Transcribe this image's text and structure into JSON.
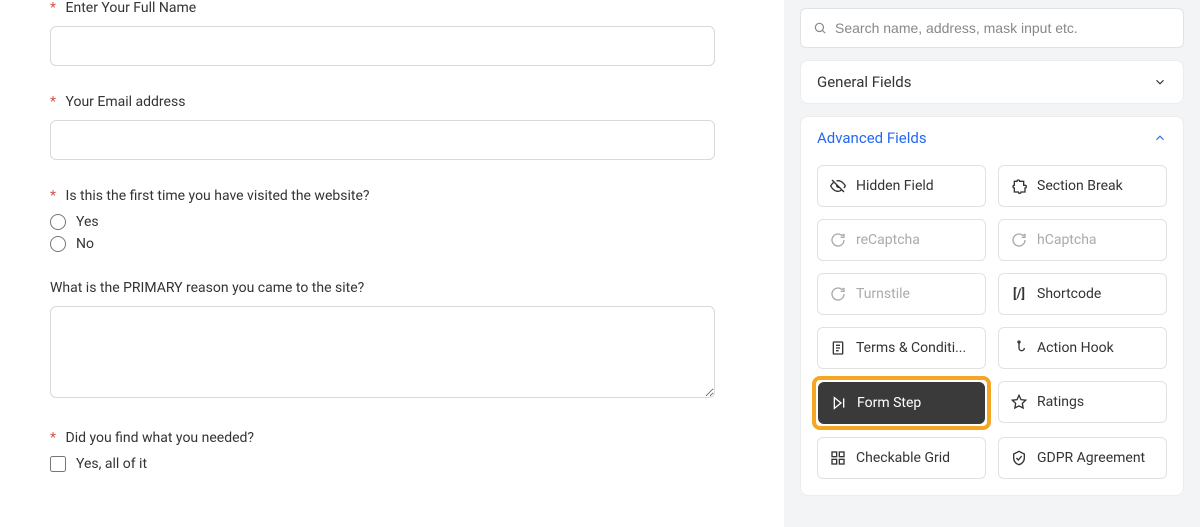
{
  "form": {
    "name": {
      "label": "Enter Your Full Name",
      "required": true
    },
    "email": {
      "label": "Your Email address",
      "required": true
    },
    "first": {
      "label": "Is this the first time you have visited the website?",
      "required": true,
      "opt_yes": "Yes",
      "opt_no": "No"
    },
    "reason": {
      "label": "What is the PRIMARY reason you came to the site?",
      "required": false
    },
    "needed": {
      "label": "Did you find what you needed?",
      "required": true,
      "opt_all": "Yes, all of it"
    }
  },
  "search": {
    "placeholder": "Search name, address, mask input etc."
  },
  "accordions": {
    "general": {
      "title": "General Fields"
    },
    "advanced": {
      "title": "Advanced Fields"
    }
  },
  "adv": {
    "hidden": "Hidden Field",
    "section": "Section Break",
    "recaptcha": "reCaptcha",
    "hcaptcha": "hCaptcha",
    "turnstile": "Turnstile",
    "shortcode": "Shortcode",
    "terms": "Terms & Conditi...",
    "action": "Action Hook",
    "formstep": "Form Step",
    "ratings": "Ratings",
    "checkable": "Checkable Grid",
    "gdpr": "GDPR Agreement"
  }
}
